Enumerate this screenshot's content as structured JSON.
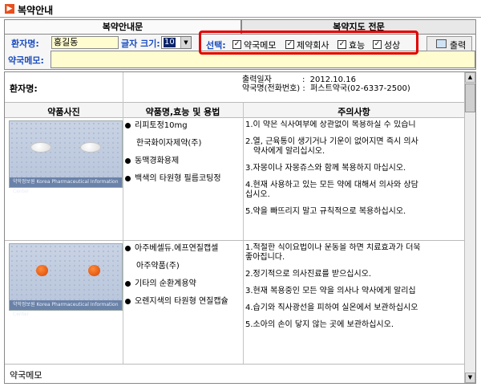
{
  "window": {
    "title": "복약안내",
    "icon": "arrow-right-icon"
  },
  "tabs": [
    {
      "label": "복약안내문"
    },
    {
      "label": "복약지도 전문"
    }
  ],
  "controls": {
    "patient_name_label": "환자명:",
    "patient_name_value": "홍길동",
    "font_size_label": "글자 크기:",
    "font_size_value": "10",
    "pharmacy_memo_label": "약국메모:",
    "select_label": "선택:",
    "options": [
      {
        "label": "약국메모",
        "checked": true
      },
      {
        "label": "제약회사",
        "checked": true
      },
      {
        "label": "효능",
        "checked": true
      },
      {
        "label": "성상",
        "checked": true
      }
    ],
    "print_label": "출력"
  },
  "document": {
    "patient_label": "환자명:",
    "print_date_line": "출력일자            :  2012.10.16",
    "pharmacy_line": "약국명(전화번호) :  퍼스트약국(02-6337-2500)",
    "columns": {
      "photo": "약품사진",
      "name": "약품명,효능 및 용법",
      "caution": "주의사항"
    },
    "drugs": [
      {
        "name": "리피토정10mg",
        "company": "한국화이자제약(주)",
        "efficacy": "동맥경화용제",
        "shape": "백색의 타원형 필름코팅정",
        "photo_caption": "약학정보원   Korea Pharmaceutical Information Center",
        "pill_color": "#ffffff",
        "cautions": [
          "1.이 약은 식사여부에 상관없이 복용하실 수 있습니",
          "2.열, 근육통이 생기거나 기운이 없어지면 즉시 의사",
          "약사에게 알리십시오.",
          "3.자몽이나 자몽쥬스와 함께 복용하지 마십시오.",
          "4.현재 사용하고 있는 모든 약에 대해서 의사와 상담",
          "십시오.",
          "5.약을 빠뜨리지 말고 규칙적으로 복용하십시오."
        ]
      },
      {
        "name": "아주베셀듀.에프연질캡셀",
        "company": "아주약품(주)",
        "efficacy": "기타의 순환계용약",
        "shape": "오렌지색의 타원형 연질캡슐",
        "photo_caption": "약학정보원   Korea Pharmaceutical Information Center",
        "pill_color": "#e85a10",
        "cautions": [
          "1.적절한 식이요법이나 운동을 하면 치료효과가 더욱",
          "좋아집니다.",
          "2.정기적으로 의사진료를 받으십시오.",
          "3.현재 복용중인 모든 약을 의사나 약사에게 알리십",
          "4.습기와 직사광선을 피하여 실온에서 보관하십시오",
          "5.소아의 손이 닿지 않는 곳에 보관하십시오."
        ]
      }
    ],
    "memo_label": "약국메모"
  }
}
